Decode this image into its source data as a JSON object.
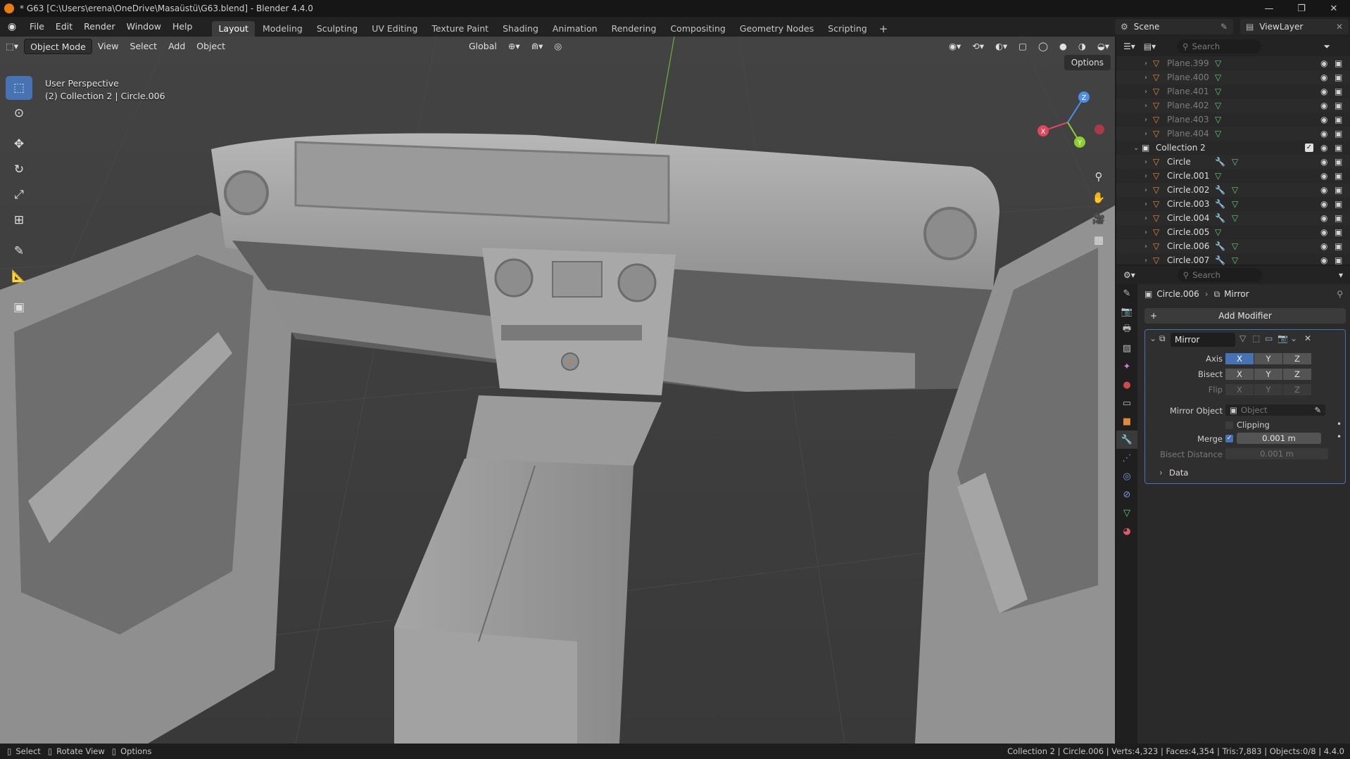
{
  "window": {
    "title": "* G63 [C:\\Users\\erena\\OneDrive\\Masaüstü\\G63.blend] - Blender 4.4.0"
  },
  "menu": [
    "File",
    "Edit",
    "Render",
    "Window",
    "Help"
  ],
  "workspaces": [
    "Layout",
    "Modeling",
    "Sculpting",
    "UV Editing",
    "Texture Paint",
    "Shading",
    "Animation",
    "Rendering",
    "Compositing",
    "Geometry Nodes",
    "Scripting"
  ],
  "scene": {
    "name": "Scene",
    "view_layer": "ViewLayer"
  },
  "viewport": {
    "mode": "Object Mode",
    "menus": [
      "View",
      "Select",
      "Add",
      "Object"
    ],
    "orientation": "Global",
    "options_label": "Options",
    "info_line1": "User Perspective",
    "info_line2": "(2) Collection 2 | Circle.006",
    "gizmo": {
      "x": "X",
      "y": "Y",
      "z": "Z"
    }
  },
  "outliner": {
    "search_placeholder": "Search",
    "rows": [
      {
        "name": "Plane.399",
        "faded": true
      },
      {
        "name": "Plane.400",
        "faded": true
      },
      {
        "name": "Plane.401",
        "faded": true
      },
      {
        "name": "Plane.402",
        "faded": true
      },
      {
        "name": "Plane.403",
        "faded": true
      },
      {
        "name": "Plane.404",
        "faded": true
      },
      {
        "name": "Collection 2",
        "collection": true
      },
      {
        "name": "Circle",
        "modifier": true
      },
      {
        "name": "Circle.001",
        "modifier": false
      },
      {
        "name": "Circle.002",
        "modifier": true
      },
      {
        "name": "Circle.003",
        "modifier": true
      },
      {
        "name": "Circle.004",
        "modifier": true
      },
      {
        "name": "Circle.005",
        "modifier": false
      },
      {
        "name": "Circle.006",
        "modifier": true
      },
      {
        "name": "Circle.007",
        "modifier": true
      }
    ]
  },
  "properties": {
    "search_placeholder": "Search",
    "object_name": "Circle.006",
    "modifier_crumb": "Mirror",
    "add_modifier_label": "Add Modifier",
    "modifier": {
      "name": "Mirror",
      "axis_label": "Axis",
      "bisect_label": "Bisect",
      "flip_label": "Flip",
      "x": "X",
      "y": "Y",
      "z": "Z",
      "mirror_object_label": "Mirror Object",
      "mirror_object_placeholder": "Object",
      "clipping_label": "Clipping",
      "merge_label": "Merge",
      "merge_value": "0.001 m",
      "bisect_distance_label": "Bisect Distance",
      "bisect_distance_value": "0.001 m",
      "data_label": "Data"
    }
  },
  "statusbar": {
    "select": "Select",
    "rotate": "Rotate View",
    "options": "Options",
    "stats": "Collection 2 | Circle.006 | Verts:4,323 | Faces:4,354 | Tris:7,883 | Objects:0/8 | 4.4.0"
  },
  "colors": {
    "accent": "#4772b3",
    "object_orange": "#e08a3c",
    "mesh_green": "#63c97b",
    "modifier_blue": "#7b9ae0"
  }
}
